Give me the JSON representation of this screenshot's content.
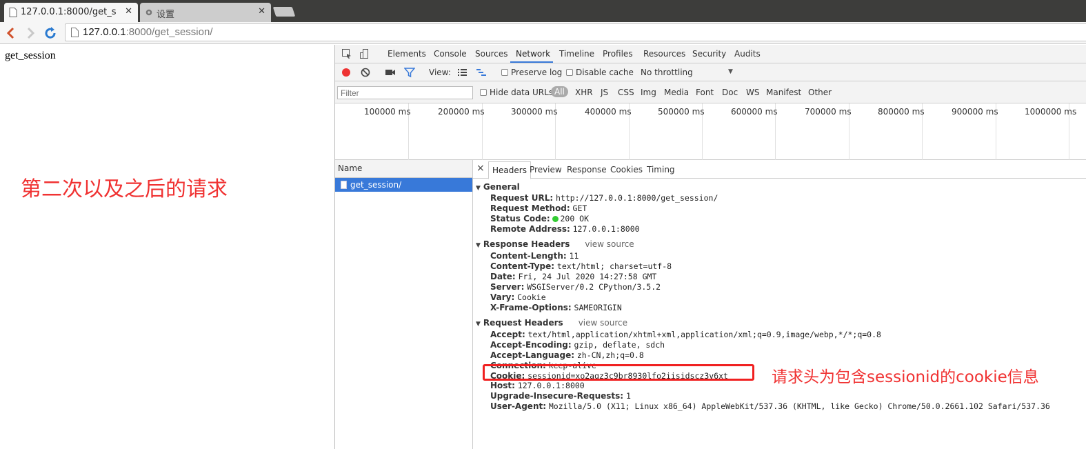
{
  "browser": {
    "tabs": [
      {
        "title": "127.0.0.1:8000/get_s",
        "close": "✕"
      },
      {
        "title": "设置",
        "close": "✕"
      }
    ],
    "url_host": "127.0.0.1",
    "url_rest": ":8000/get_session/"
  },
  "page": {
    "body_text": "get_session",
    "annotation": "第二次以及之后的请求"
  },
  "devtools": {
    "tabs": [
      "Elements",
      "Console",
      "Sources",
      "Network",
      "Timeline",
      "Profiles",
      "Resources",
      "Security",
      "Audits"
    ],
    "active_tab": "Network",
    "controls": {
      "view_label": "View:",
      "preserve_log": "Preserve log",
      "disable_cache": "Disable cache",
      "throttling": "No throttling"
    },
    "filter": {
      "placeholder": "Filter",
      "hide_data_urls": "Hide data URLs",
      "types": [
        "All",
        "XHR",
        "JS",
        "CSS",
        "Img",
        "Media",
        "Font",
        "Doc",
        "WS",
        "Manifest",
        "Other"
      ]
    },
    "timeline_labels": [
      "100000 ms",
      "200000 ms",
      "300000 ms",
      "400000 ms",
      "500000 ms",
      "600000 ms",
      "700000 ms",
      "800000 ms",
      "900000 ms",
      "1000000 ms"
    ],
    "requests": {
      "column": "Name",
      "rows": [
        "get_session/"
      ]
    },
    "detail_tabs": [
      "Headers",
      "Preview",
      "Response",
      "Cookies",
      "Timing"
    ],
    "general": {
      "title": "General",
      "items": [
        {
          "k": "Request URL:",
          "v": "http://127.0.0.1:8000/get_session/"
        },
        {
          "k": "Request Method:",
          "v": "GET"
        },
        {
          "k": "Status Code:",
          "v": "200 OK"
        },
        {
          "k": "Remote Address:",
          "v": "127.0.0.1:8000"
        }
      ]
    },
    "response_headers": {
      "title": "Response Headers",
      "view_source": "view source",
      "items": [
        {
          "k": "Content-Length:",
          "v": "11"
        },
        {
          "k": "Content-Type:",
          "v": "text/html; charset=utf-8"
        },
        {
          "k": "Date:",
          "v": "Fri, 24 Jul 2020 14:27:58 GMT"
        },
        {
          "k": "Server:",
          "v": "WSGIServer/0.2 CPython/3.5.2"
        },
        {
          "k": "Vary:",
          "v": "Cookie"
        },
        {
          "k": "X-Frame-Options:",
          "v": "SAMEORIGIN"
        }
      ]
    },
    "request_headers": {
      "title": "Request Headers",
      "view_source": "view source",
      "items": [
        {
          "k": "Accept:",
          "v": "text/html,application/xhtml+xml,application/xml;q=0.9,image/webp,*/*;q=0.8"
        },
        {
          "k": "Accept-Encoding:",
          "v": "gzip, deflate, sdch"
        },
        {
          "k": "Accept-Language:",
          "v": "zh-CN,zh;q=0.8"
        },
        {
          "k": "Connection:",
          "v": "keep-alive"
        },
        {
          "k": "Cookie:",
          "v": "sessionid=xo2agz3c9br8930lfo2iisidscz3v6xt"
        },
        {
          "k": "Host:",
          "v": "127.0.0.1:8000"
        },
        {
          "k": "Upgrade-Insecure-Requests:",
          "v": "1"
        },
        {
          "k": "User-Agent:",
          "v": "Mozilla/5.0 (X11; Linux x86_64) AppleWebKit/537.36 (KHTML, like Gecko) Chrome/50.0.2661.102 Safari/537.36"
        }
      ]
    },
    "cookie_annotation": "请求头为包含sessionid的cookie信息"
  },
  "colors": {
    "annotation_red": "#f03232",
    "selected_blue": "#3879d9",
    "record_red": "#e33"
  }
}
